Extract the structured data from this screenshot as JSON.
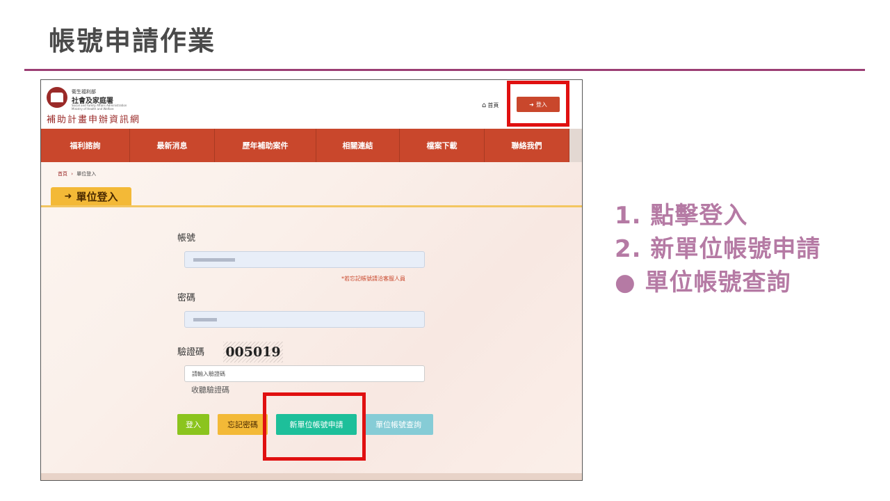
{
  "slide": {
    "title": "帳號申請作業"
  },
  "site": {
    "org_small": "衛生福利部",
    "org_name": "社會及家庭署",
    "org_en": "Social and Family Affairs Administration Ministry of Health and Welfare",
    "site_name": "補助計畫申辦資訊網",
    "home_label": "首頁",
    "login_label": "登入"
  },
  "nav": {
    "items": [
      {
        "label": "福利諮詢"
      },
      {
        "label": "最新消息"
      },
      {
        "label": "歷年補助案件"
      },
      {
        "label": "相關連結"
      },
      {
        "label": "檔案下載"
      },
      {
        "label": "聯絡我們"
      }
    ]
  },
  "breadcrumb": {
    "home": "首頁",
    "separator": "›",
    "current": "單位登入"
  },
  "page_tab": {
    "label": "單位登入"
  },
  "form": {
    "account_label": "帳號",
    "forgot_note": "*若忘記帳號請洽客服人員",
    "password_label": "密碼",
    "captcha_label": "驗證碼",
    "captcha_value": "005019",
    "captcha_placeholder": "請輸入驗證碼",
    "listen_captcha": "收聽驗證碼"
  },
  "buttons": {
    "login": "登入",
    "forgot_password": "忘記密碼",
    "new_account": "新單位帳號申請",
    "account_query": "單位帳號查詢"
  },
  "colors": {
    "accent_purple": "#9b3e74",
    "steps_text": "#b57aa4",
    "nav_red": "#c9472c",
    "highlight_red": "#e01010",
    "btn_login": "#8bc41e",
    "btn_forgot": "#f3b937",
    "btn_new": "#1dbf9a",
    "btn_query": "#86ccd6"
  },
  "steps": [
    "1. 點擊登入",
    "2. 新單位帳號申請",
    "● 單位帳號查詢"
  ]
}
